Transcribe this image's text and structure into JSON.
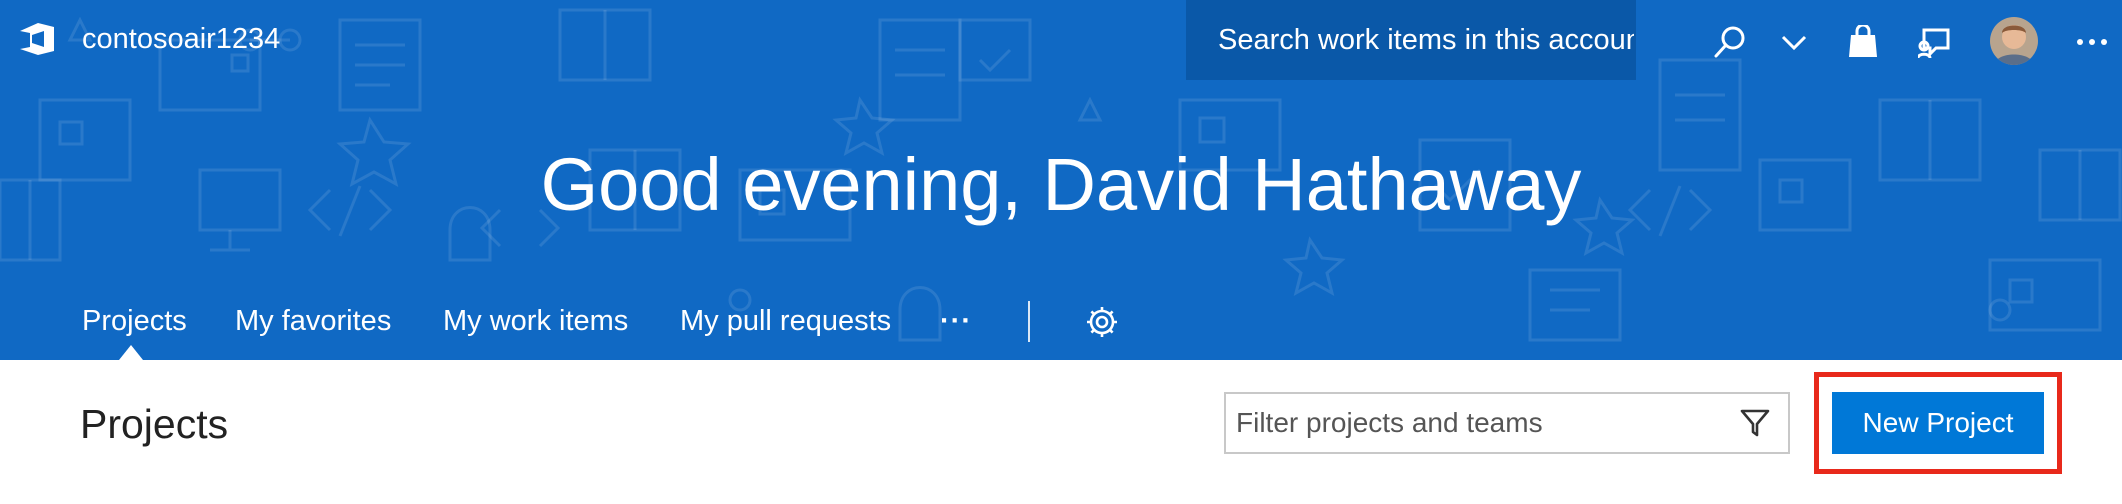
{
  "header": {
    "logo_icon": "azure-devops-logo-icon",
    "account_name": "contosoair1234",
    "search": {
      "placeholder": "Search work items in this account",
      "value": ""
    },
    "icons": [
      "search-icon",
      "chevron-down-icon",
      "shopping-bag-icon",
      "feedback-icon",
      "avatar",
      "more-icon"
    ]
  },
  "hero": {
    "greeting": "Good evening, David Hathaway",
    "tabs": [
      {
        "label": "Projects",
        "selected": true
      },
      {
        "label": "My favorites"
      },
      {
        "label": "My work items"
      },
      {
        "label": "My pull requests"
      }
    ],
    "more_glyph": "···",
    "settings_icon": "gear-icon"
  },
  "main": {
    "title": "Projects",
    "filter": {
      "placeholder": "Filter projects and teams",
      "value": "",
      "icon": "filter-funnel-icon"
    },
    "new_project_label": "New Project"
  },
  "colors": {
    "hero_bg": "#1069c4",
    "search_bg": "#0a58a8",
    "primary": "#0078d7",
    "highlight": "#e8291b"
  }
}
